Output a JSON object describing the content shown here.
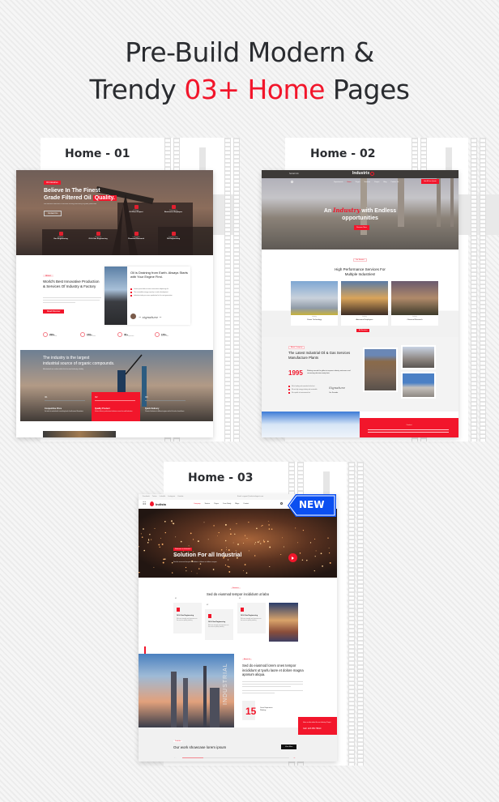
{
  "headline": {
    "line1": "Pre-Build Modern &",
    "line2_prefix": "Trendy ",
    "line2_accent": "03+ Home",
    "line2_suffix": " Pages",
    "accent_color": "#f2162b"
  },
  "home1": {
    "label": "Home - 01",
    "hero": {
      "tag": "Oil Industries",
      "title_line1": "Believe In The Finest",
      "title_line2": "Grade Filtered Oil",
      "title_highlight": "Quality.",
      "subtitle": "We welcome industries & increase factory processing of grade production",
      "button": "Contact Us",
      "services": [
        {
          "cat": "Refinery",
          "name": "Oil Plant Project",
          "icon": "factory-icon"
        },
        {
          "cat": "Engineering",
          "name": "Bueisness Employee",
          "icon": "worker-icon"
        },
        {
          "cat": "Refinery",
          "name": "Gas Engineering",
          "icon": "pipes-icon"
        },
        {
          "cat": "Research",
          "name": "Oil & Gas Engineering",
          "icon": "truck-icon"
        },
        {
          "cat": "Lubrication",
          "name": "Chemical Research",
          "icon": "pin-icon"
        },
        {
          "cat": "Transportation",
          "name": "Oil Engineering",
          "icon": "engine-icon"
        }
      ]
    },
    "about": {
      "tag": "About",
      "title": "World's Best Innovative Production & Services Of Industry & Factory",
      "button": "Read Discover",
      "card_title": "Oil is Draining from Earth. Always Starts with Your Engine First.",
      "checks": [
        "Lorem ipsum dolor sit amet consectetur adipiscing elit",
        "The renewable energy capacity is under development",
        "Industries today are more productive for the next generation"
      ]
    },
    "stats": [
      {
        "value": "200+",
        "label": "Global Users"
      },
      {
        "value": "150+",
        "label": "Excellent Team"
      },
      {
        "value": "35+",
        "label": "Years Experience"
      },
      {
        "value": "170+",
        "label": "Awards Won"
      }
    ],
    "banner": {
      "title_line1": "The industry is the largest",
      "title_line2": "industrial source of organic compounds.",
      "subtitle": "Maintained our values while the focused industry reliably",
      "features": [
        {
          "num": "/01",
          "title": "Competitive Price",
          "text": "Get what is needed with a matching level of well-earned Sensations"
        },
        {
          "num": "/02",
          "title": "Quality Product",
          "text": "Deliver efficient, professional solutions across the world industries"
        },
        {
          "num": "/03",
          "title": "Quick Delivery",
          "text": "Chemical deliveries to different regions with a full scale of excellence"
        }
      ]
    }
  },
  "home2": {
    "label": "Home - 02",
    "topbar": {
      "social_label": "Social Info",
      "logo": "Industrix"
    },
    "nav": [
      "Departments",
      "Home",
      "Pages",
      "Services",
      "Project",
      "Blog",
      "Contact Us"
    ],
    "cta": "Get A Free Quote",
    "hero": {
      "title_prefix": "An ",
      "title_accent": "Industry",
      "title_suffix": " with Endless",
      "title_line2": "opportunities",
      "button": "Discover More"
    },
    "services": {
      "tag": "Our Service",
      "title_line1": "High Performance Services For",
      "title_line2": "Multiple Industries!",
      "cards": [
        {
          "cat": "Industry",
          "name": "Power Technology"
        },
        {
          "cat": "Industry",
          "name": "Awesome Employees"
        },
        {
          "cat": "Industry",
          "name": "Chemical Research"
        }
      ],
      "button": "All Services"
    },
    "about": {
      "tag": "About Company",
      "title_line1": "The Latest Industrial Oil & Gas Services",
      "title_line2": "Manufacture Plants",
      "year": "1995",
      "year_text": "Working around the globe to improve industry outcomes and connecting decision-ready data",
      "checks": [
        "We're leading and committed to the best",
        "We are high energy industry and sustainable",
        "We capable of environmental art"
      ],
      "signer": "Our Founder"
    },
    "footer_tag": "Contact"
  },
  "home3": {
    "label": "Home - 03",
    "badge": "NEW",
    "topbar": {
      "breadcrumbs": [
        "Facebook",
        "Twitter",
        "LinkedIn",
        "Instagram",
        "Youtube"
      ],
      "contact": "Email: support@industrialagent.com"
    },
    "logo": "Indista",
    "nav": [
      "Company",
      "Service",
      "Pages",
      "Case Study",
      "Blogs",
      "Contact"
    ],
    "hero": {
      "tag": "Welcome to Industrial",
      "title": "Solution For all Industrial",
      "subtitle": "Sed do eiusmod tempor incididunt ut labore et dolore magna"
    },
    "services": {
      "tag": "Services",
      "title": "Sed do eiusmod tempor incididunt ut labo",
      "cards": [
        {
          "num": "01",
          "name": "Oil & Gas Engineering",
          "text": "We have strength and experience in the services quality industry"
        },
        {
          "num": "02",
          "name": "Oil & Gas Engineering",
          "text": "We have strength and experience in the services quality industry"
        },
        {
          "num": "03",
          "name": "Oil & Gas Engineering",
          "text": "We have strength and experience in the services quality industry"
        }
      ]
    },
    "about": {
      "side_text": "INDUSTRIAL",
      "tag": "About Us",
      "title": "Sed do eiusmod lorem ones tempor incididunt ut tyurlu laore et dolore magna aposum aliqua.",
      "years": "15",
      "years_label": "Years Experience Working",
      "cta_text": "Have an idea about the our Industry Project",
      "cta_phone": "Call: 123 456 78910"
    },
    "showcase": {
      "tag": "Portfolio",
      "title": "Our work showcase lorem ipsum",
      "button": "View More",
      "progress": 0.2
    }
  }
}
